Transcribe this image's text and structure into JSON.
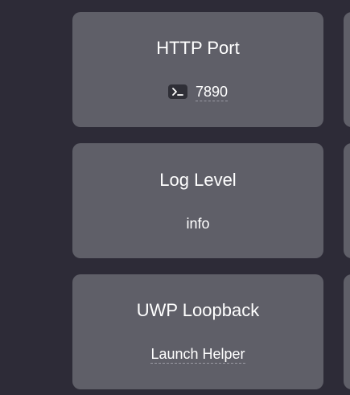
{
  "cards": [
    {
      "title": "HTTP Port",
      "value": "7890",
      "icon": "terminal-icon"
    },
    {
      "title": "Log Level",
      "value": "info"
    },
    {
      "title": "UWP Loopback",
      "value": "Launch Helper"
    }
  ],
  "colors": {
    "background": "#2d2b37",
    "card": "#5f5f68",
    "text": "#ffffff",
    "icon_bg": "#2f2f37"
  }
}
